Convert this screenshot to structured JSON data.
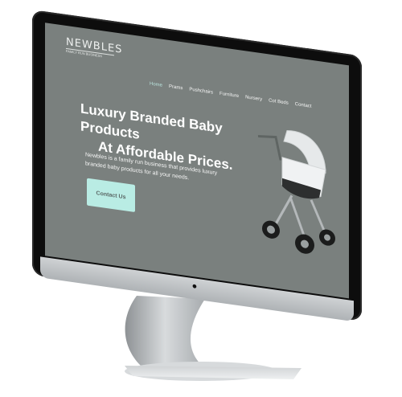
{
  "brand": {
    "name": "NEWBLES",
    "tagline": "FAMILY RUN BUSINESS"
  },
  "nav": {
    "items": [
      {
        "label": "Home",
        "active": true
      },
      {
        "label": "Prams"
      },
      {
        "label": "Pushchairs"
      },
      {
        "label": "Furniture"
      },
      {
        "label": "Nursery"
      },
      {
        "label": "Cot Beds"
      },
      {
        "label": "Contact"
      }
    ]
  },
  "hero": {
    "title_line1": "Luxury Branded Baby Products",
    "title_line2": "At Affordable Prices.",
    "body": "Newbles is a family run business that provides luxury branded baby products for all your needs.",
    "cta_label": "Contact Us"
  },
  "colors": {
    "screen_bg": "#7a807e",
    "accent": "#b9ece4",
    "bezel": "#0d0d0d"
  },
  "icons": {
    "stand_logo": "apple-icon",
    "product": "stroller-icon"
  }
}
